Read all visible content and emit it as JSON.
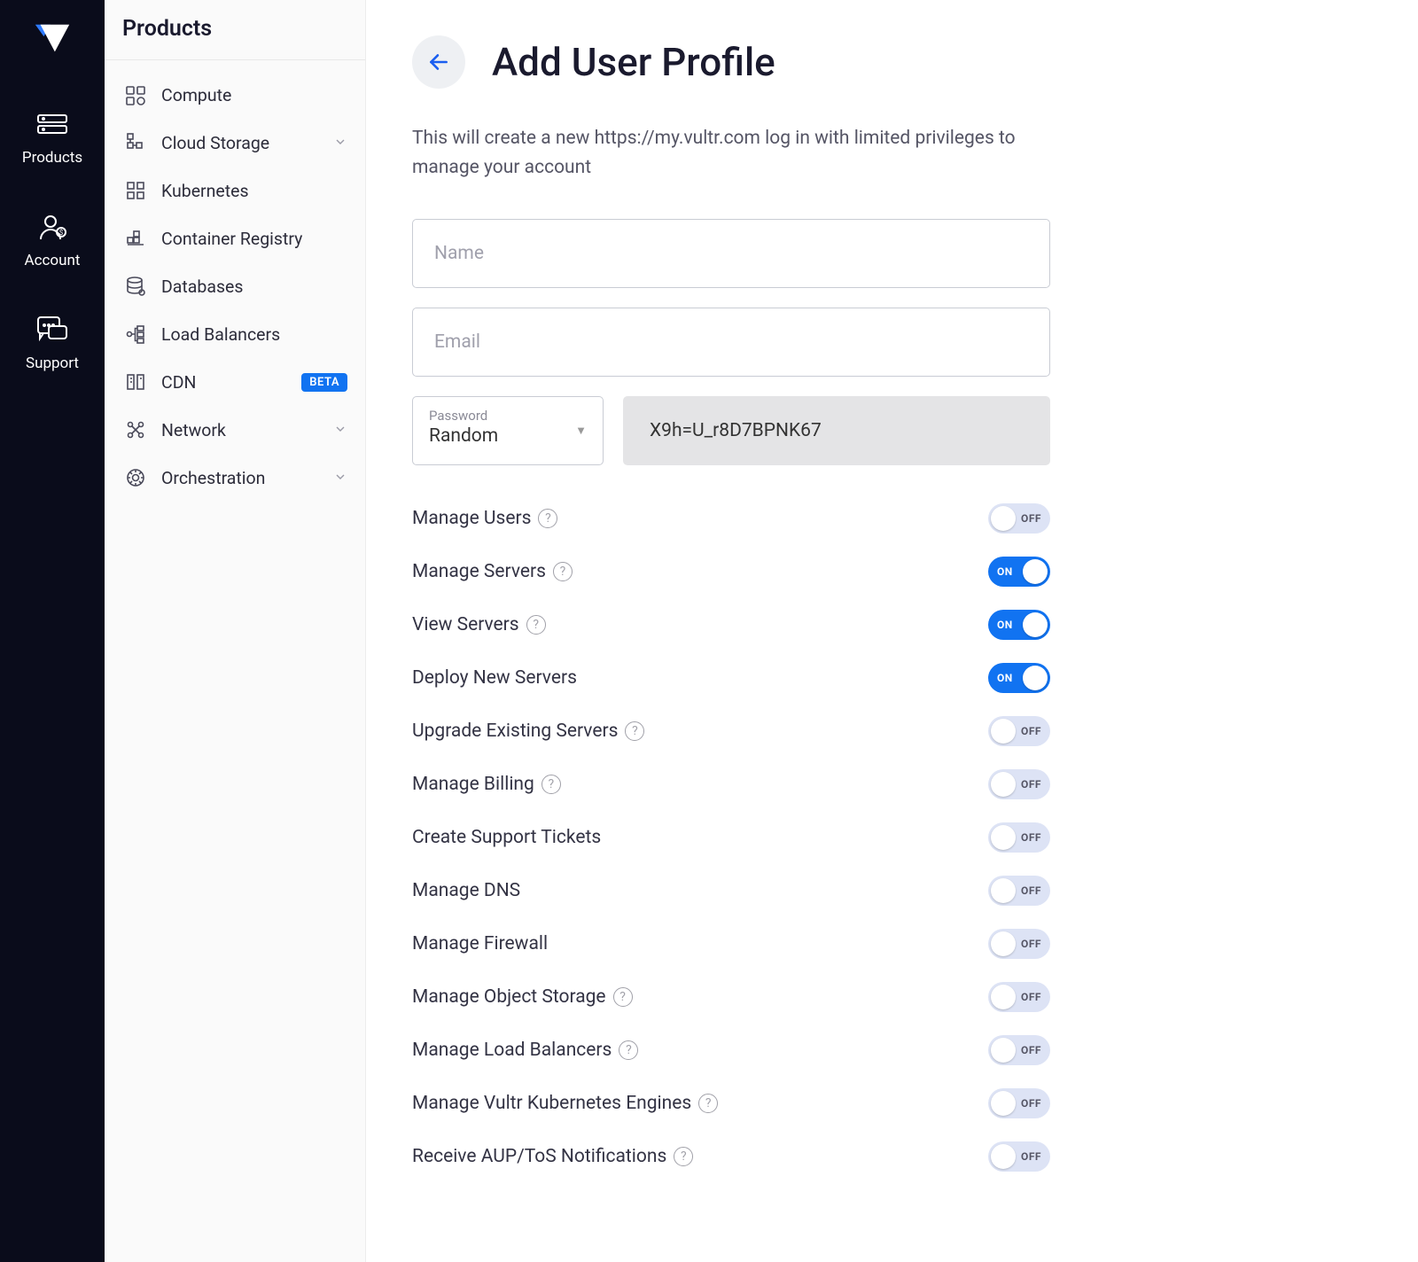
{
  "rail": {
    "items": [
      {
        "label": "Products"
      },
      {
        "label": "Account"
      },
      {
        "label": "Support"
      }
    ]
  },
  "sidebar": {
    "title": "Products",
    "items": [
      {
        "label": "Compute",
        "icon": "compute",
        "expandable": false,
        "badge": null
      },
      {
        "label": "Cloud Storage",
        "icon": "storage",
        "expandable": true,
        "badge": null
      },
      {
        "label": "Kubernetes",
        "icon": "k8s",
        "expandable": false,
        "badge": null
      },
      {
        "label": "Container Registry",
        "icon": "registry",
        "expandable": false,
        "badge": null
      },
      {
        "label": "Databases",
        "icon": "database",
        "expandable": false,
        "badge": null
      },
      {
        "label": "Load Balancers",
        "icon": "lb",
        "expandable": false,
        "badge": null
      },
      {
        "label": "CDN",
        "icon": "cdn",
        "expandable": false,
        "badge": "BETA"
      },
      {
        "label": "Network",
        "icon": "network",
        "expandable": true,
        "badge": null
      },
      {
        "label": "Orchestration",
        "icon": "orchestrate",
        "expandable": true,
        "badge": null
      }
    ]
  },
  "main": {
    "title": "Add User Profile",
    "description": "This will create a new https://my.vultr.com log in with limited privileges to manage your account",
    "name_placeholder": "Name",
    "email_placeholder": "Email",
    "password_select_label": "Password",
    "password_select_value": "Random",
    "password_value": "X9h=U_r8D7BPNK67",
    "on_text": "ON",
    "off_text": "OFF",
    "permissions": [
      {
        "label": "Manage Users",
        "help": true,
        "on": false
      },
      {
        "label": "Manage Servers",
        "help": true,
        "on": true
      },
      {
        "label": "View Servers",
        "help": true,
        "on": true
      },
      {
        "label": "Deploy New Servers",
        "help": false,
        "on": true
      },
      {
        "label": "Upgrade Existing Servers",
        "help": true,
        "on": false
      },
      {
        "label": "Manage Billing",
        "help": true,
        "on": false
      },
      {
        "label": "Create Support Tickets",
        "help": false,
        "on": false
      },
      {
        "label": "Manage DNS",
        "help": false,
        "on": false
      },
      {
        "label": "Manage Firewall",
        "help": false,
        "on": false
      },
      {
        "label": "Manage Object Storage",
        "help": true,
        "on": false
      },
      {
        "label": "Manage Load Balancers",
        "help": true,
        "on": false
      },
      {
        "label": "Manage Vultr Kubernetes Engines",
        "help": true,
        "on": false
      },
      {
        "label": "Receive AUP/ToS Notifications",
        "help": true,
        "on": false
      }
    ]
  }
}
